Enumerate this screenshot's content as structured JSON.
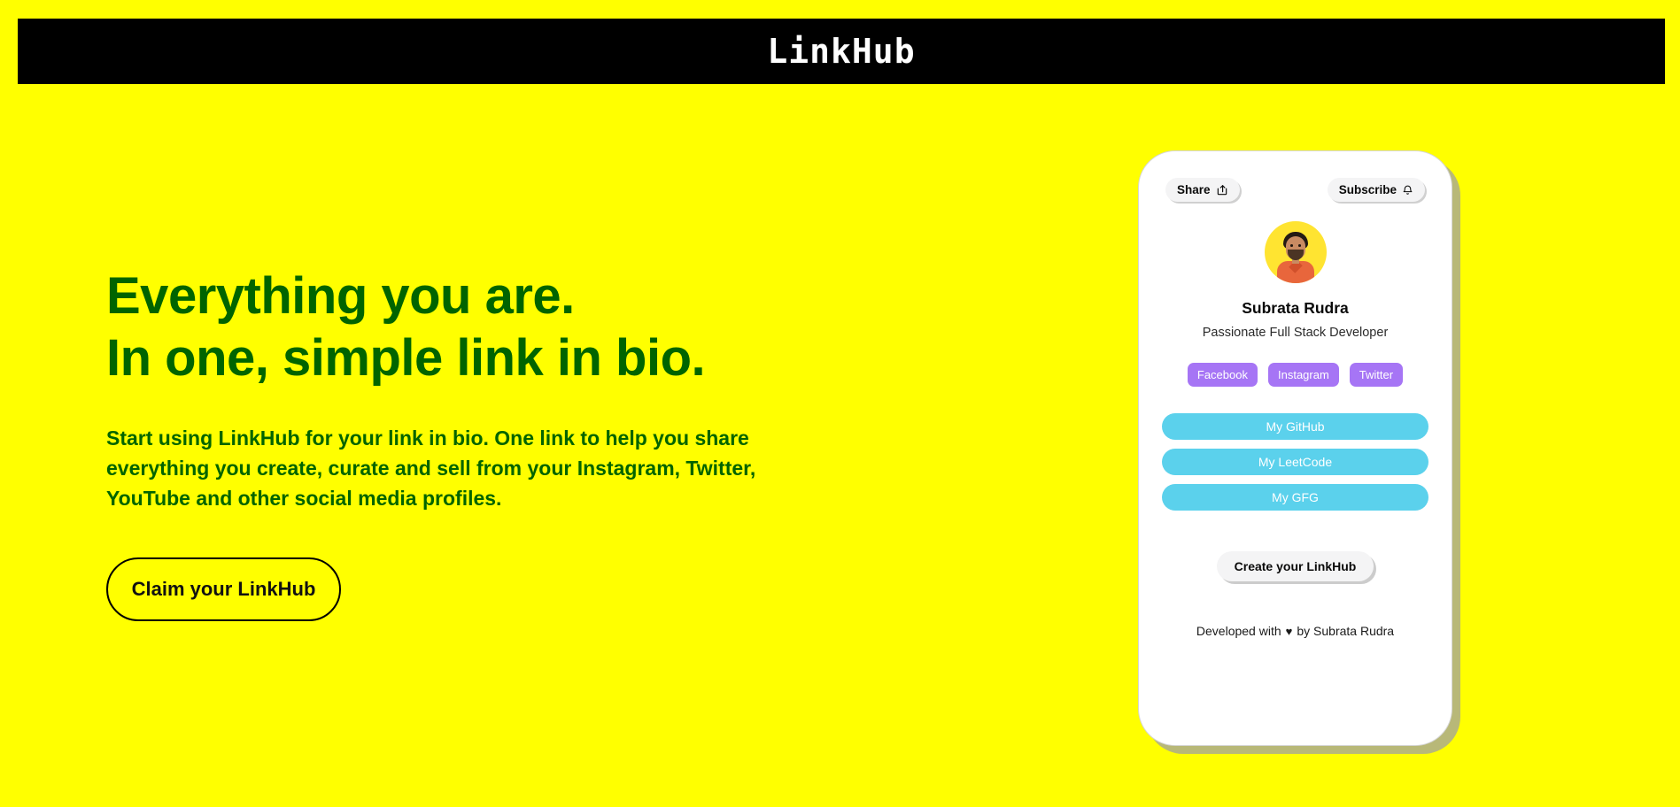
{
  "header": {
    "title": "LinkHub",
    "background": "#000000",
    "text_color": "#ffffff"
  },
  "page": {
    "background": "#ffff00",
    "accent_green": "#006400",
    "accent_cyan": "#5bd1ec",
    "accent_purple": "#a675f5"
  },
  "hero": {
    "headline_line1": "Everything you are.",
    "headline_line2": "In one, simple link in bio.",
    "subtext": "Start using LinkHub for your link in bio. One link to help you share everything you create, curate and sell from your Instagram, Twitter, YouTube and other social media profiles.",
    "cta_label": "Claim your LinkHub"
  },
  "card": {
    "share_label": "Share",
    "share_icon": "share-icon",
    "subscribe_label": "Subscribe",
    "subscribe_icon": "bell-icon",
    "avatar_icon": "avatar",
    "profile_name": "Subrata Rudra",
    "profile_bio": "Passionate Full Stack Developer",
    "tags": [
      {
        "label": "Facebook"
      },
      {
        "label": "Instagram"
      },
      {
        "label": "Twitter"
      }
    ],
    "links": [
      {
        "label": "My GitHub"
      },
      {
        "label": "My LeetCode"
      },
      {
        "label": "My GFG"
      }
    ],
    "create_label": "Create your LinkHub",
    "footer_prefix": "Developed with",
    "footer_heart": "♥",
    "footer_suffix": "by Subrata Rudra"
  }
}
